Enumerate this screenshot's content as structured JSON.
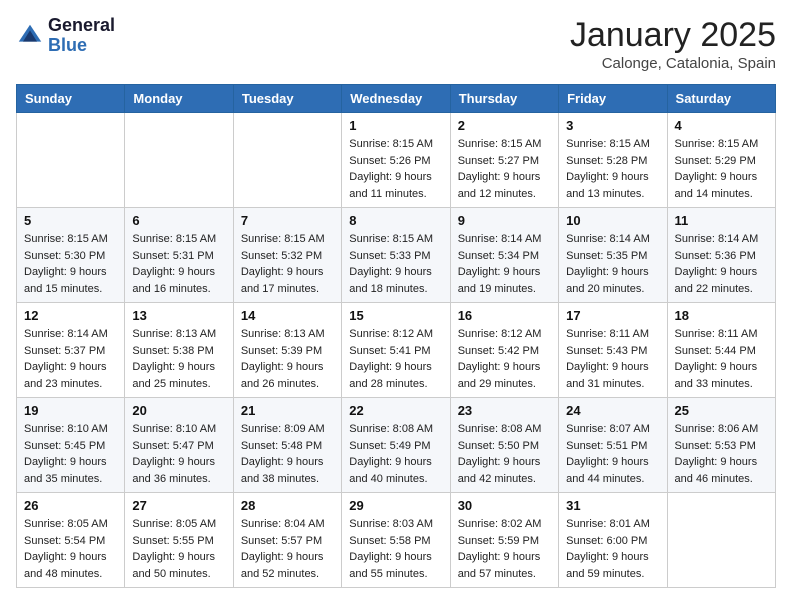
{
  "header": {
    "logo_general": "General",
    "logo_blue": "Blue",
    "month_title": "January 2025",
    "location": "Calonge, Catalonia, Spain"
  },
  "weekdays": [
    "Sunday",
    "Monday",
    "Tuesday",
    "Wednesday",
    "Thursday",
    "Friday",
    "Saturday"
  ],
  "weeks": [
    [
      {
        "day": "",
        "sunrise": "",
        "sunset": "",
        "daylight": ""
      },
      {
        "day": "",
        "sunrise": "",
        "sunset": "",
        "daylight": ""
      },
      {
        "day": "",
        "sunrise": "",
        "sunset": "",
        "daylight": ""
      },
      {
        "day": "1",
        "sunrise": "Sunrise: 8:15 AM",
        "sunset": "Sunset: 5:26 PM",
        "daylight": "Daylight: 9 hours and 11 minutes."
      },
      {
        "day": "2",
        "sunrise": "Sunrise: 8:15 AM",
        "sunset": "Sunset: 5:27 PM",
        "daylight": "Daylight: 9 hours and 12 minutes."
      },
      {
        "day": "3",
        "sunrise": "Sunrise: 8:15 AM",
        "sunset": "Sunset: 5:28 PM",
        "daylight": "Daylight: 9 hours and 13 minutes."
      },
      {
        "day": "4",
        "sunrise": "Sunrise: 8:15 AM",
        "sunset": "Sunset: 5:29 PM",
        "daylight": "Daylight: 9 hours and 14 minutes."
      }
    ],
    [
      {
        "day": "5",
        "sunrise": "Sunrise: 8:15 AM",
        "sunset": "Sunset: 5:30 PM",
        "daylight": "Daylight: 9 hours and 15 minutes."
      },
      {
        "day": "6",
        "sunrise": "Sunrise: 8:15 AM",
        "sunset": "Sunset: 5:31 PM",
        "daylight": "Daylight: 9 hours and 16 minutes."
      },
      {
        "day": "7",
        "sunrise": "Sunrise: 8:15 AM",
        "sunset": "Sunset: 5:32 PM",
        "daylight": "Daylight: 9 hours and 17 minutes."
      },
      {
        "day": "8",
        "sunrise": "Sunrise: 8:15 AM",
        "sunset": "Sunset: 5:33 PM",
        "daylight": "Daylight: 9 hours and 18 minutes."
      },
      {
        "day": "9",
        "sunrise": "Sunrise: 8:14 AM",
        "sunset": "Sunset: 5:34 PM",
        "daylight": "Daylight: 9 hours and 19 minutes."
      },
      {
        "day": "10",
        "sunrise": "Sunrise: 8:14 AM",
        "sunset": "Sunset: 5:35 PM",
        "daylight": "Daylight: 9 hours and 20 minutes."
      },
      {
        "day": "11",
        "sunrise": "Sunrise: 8:14 AM",
        "sunset": "Sunset: 5:36 PM",
        "daylight": "Daylight: 9 hours and 22 minutes."
      }
    ],
    [
      {
        "day": "12",
        "sunrise": "Sunrise: 8:14 AM",
        "sunset": "Sunset: 5:37 PM",
        "daylight": "Daylight: 9 hours and 23 minutes."
      },
      {
        "day": "13",
        "sunrise": "Sunrise: 8:13 AM",
        "sunset": "Sunset: 5:38 PM",
        "daylight": "Daylight: 9 hours and 25 minutes."
      },
      {
        "day": "14",
        "sunrise": "Sunrise: 8:13 AM",
        "sunset": "Sunset: 5:39 PM",
        "daylight": "Daylight: 9 hours and 26 minutes."
      },
      {
        "day": "15",
        "sunrise": "Sunrise: 8:12 AM",
        "sunset": "Sunset: 5:41 PM",
        "daylight": "Daylight: 9 hours and 28 minutes."
      },
      {
        "day": "16",
        "sunrise": "Sunrise: 8:12 AM",
        "sunset": "Sunset: 5:42 PM",
        "daylight": "Daylight: 9 hours and 29 minutes."
      },
      {
        "day": "17",
        "sunrise": "Sunrise: 8:11 AM",
        "sunset": "Sunset: 5:43 PM",
        "daylight": "Daylight: 9 hours and 31 minutes."
      },
      {
        "day": "18",
        "sunrise": "Sunrise: 8:11 AM",
        "sunset": "Sunset: 5:44 PM",
        "daylight": "Daylight: 9 hours and 33 minutes."
      }
    ],
    [
      {
        "day": "19",
        "sunrise": "Sunrise: 8:10 AM",
        "sunset": "Sunset: 5:45 PM",
        "daylight": "Daylight: 9 hours and 35 minutes."
      },
      {
        "day": "20",
        "sunrise": "Sunrise: 8:10 AM",
        "sunset": "Sunset: 5:47 PM",
        "daylight": "Daylight: 9 hours and 36 minutes."
      },
      {
        "day": "21",
        "sunrise": "Sunrise: 8:09 AM",
        "sunset": "Sunset: 5:48 PM",
        "daylight": "Daylight: 9 hours and 38 minutes."
      },
      {
        "day": "22",
        "sunrise": "Sunrise: 8:08 AM",
        "sunset": "Sunset: 5:49 PM",
        "daylight": "Daylight: 9 hours and 40 minutes."
      },
      {
        "day": "23",
        "sunrise": "Sunrise: 8:08 AM",
        "sunset": "Sunset: 5:50 PM",
        "daylight": "Daylight: 9 hours and 42 minutes."
      },
      {
        "day": "24",
        "sunrise": "Sunrise: 8:07 AM",
        "sunset": "Sunset: 5:51 PM",
        "daylight": "Daylight: 9 hours and 44 minutes."
      },
      {
        "day": "25",
        "sunrise": "Sunrise: 8:06 AM",
        "sunset": "Sunset: 5:53 PM",
        "daylight": "Daylight: 9 hours and 46 minutes."
      }
    ],
    [
      {
        "day": "26",
        "sunrise": "Sunrise: 8:05 AM",
        "sunset": "Sunset: 5:54 PM",
        "daylight": "Daylight: 9 hours and 48 minutes."
      },
      {
        "day": "27",
        "sunrise": "Sunrise: 8:05 AM",
        "sunset": "Sunset: 5:55 PM",
        "daylight": "Daylight: 9 hours and 50 minutes."
      },
      {
        "day": "28",
        "sunrise": "Sunrise: 8:04 AM",
        "sunset": "Sunset: 5:57 PM",
        "daylight": "Daylight: 9 hours and 52 minutes."
      },
      {
        "day": "29",
        "sunrise": "Sunrise: 8:03 AM",
        "sunset": "Sunset: 5:58 PM",
        "daylight": "Daylight: 9 hours and 55 minutes."
      },
      {
        "day": "30",
        "sunrise": "Sunrise: 8:02 AM",
        "sunset": "Sunset: 5:59 PM",
        "daylight": "Daylight: 9 hours and 57 minutes."
      },
      {
        "day": "31",
        "sunrise": "Sunrise: 8:01 AM",
        "sunset": "Sunset: 6:00 PM",
        "daylight": "Daylight: 9 hours and 59 minutes."
      },
      {
        "day": "",
        "sunrise": "",
        "sunset": "",
        "daylight": ""
      }
    ]
  ]
}
